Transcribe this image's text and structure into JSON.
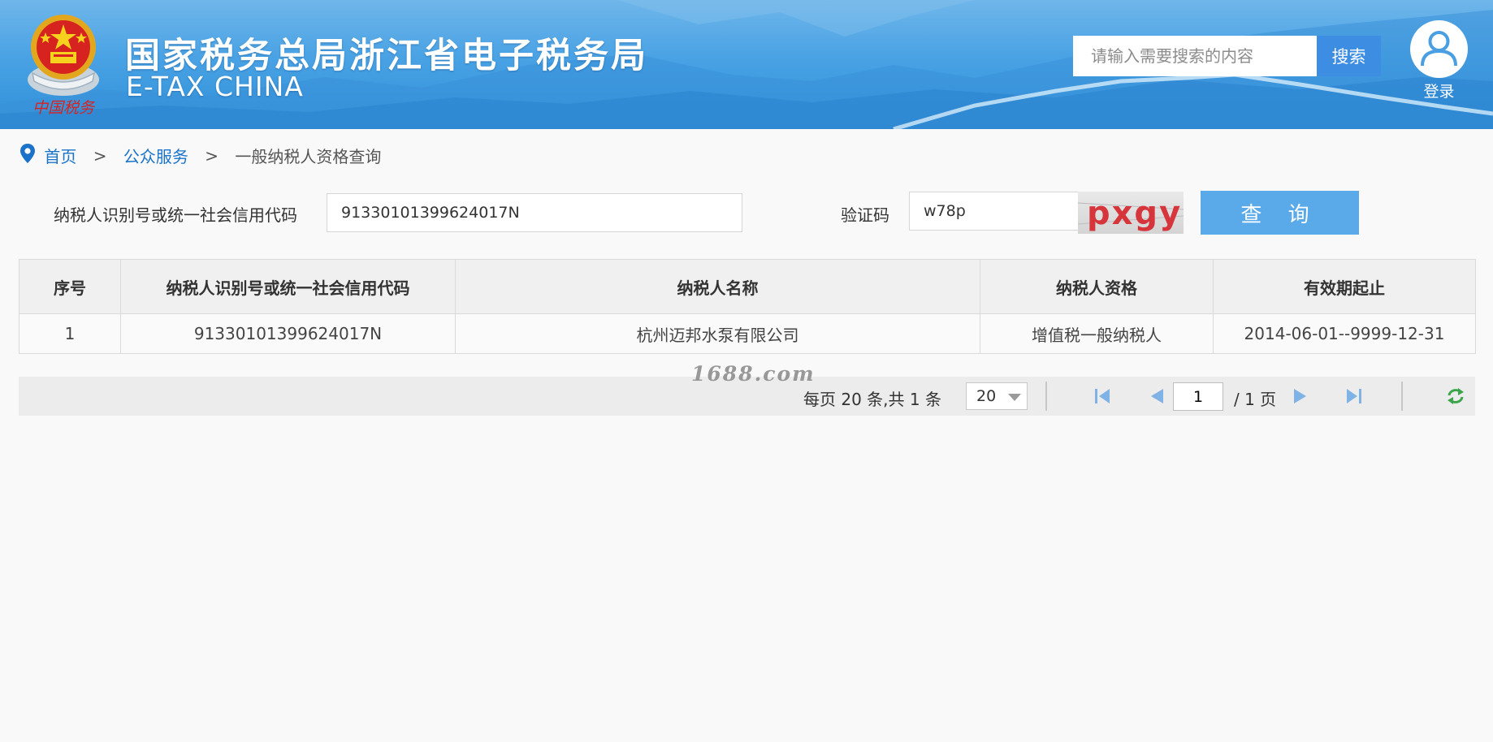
{
  "header": {
    "logo_text": "中国税务",
    "title_cn": "国家税务总局浙江省电子税务局",
    "title_en": "E-TAX CHINA",
    "search": {
      "placeholder": "请输入需要搜索的内容",
      "button_label": "搜索"
    },
    "login_label": "登录"
  },
  "breadcrumb": {
    "home": "首页",
    "separator": ">",
    "section": "公众服务",
    "current": "一般纳税人资格查询"
  },
  "form": {
    "taxpayer_id_label": "纳税人识别号或统一社会信用代码",
    "taxpayer_id_value": "91330101399624017N",
    "captcha_label": "验证码",
    "captcha_value": "w78p",
    "captcha_image_text": "pxgy",
    "query_button": "查 询"
  },
  "table": {
    "headers": [
      "序号",
      "纳税人识别号或统一社会信用代码",
      "纳税人名称",
      "纳税人资格",
      "有效期起止"
    ],
    "rows": [
      [
        "1",
        "91330101399624017N",
        "杭州迈邦水泵有限公司",
        "增值税一般纳税人",
        "2014-06-01--9999-12-31"
      ]
    ]
  },
  "pagination": {
    "info": "每页 20 条,共 1 条",
    "page_size": "20",
    "current_page": "1",
    "total_pages": "/ 1 页"
  },
  "watermark": "1688.com",
  "colors": {
    "header_blue": "#49a2e4",
    "link": "#1a73c9",
    "query_button": "#5aaaea",
    "search_button": "#3d8de2"
  },
  "icons": [
    "location-pin-icon",
    "user-icon",
    "first-page-icon",
    "prev-page-icon",
    "next-page-icon",
    "last-page-icon",
    "refresh-icon"
  ]
}
